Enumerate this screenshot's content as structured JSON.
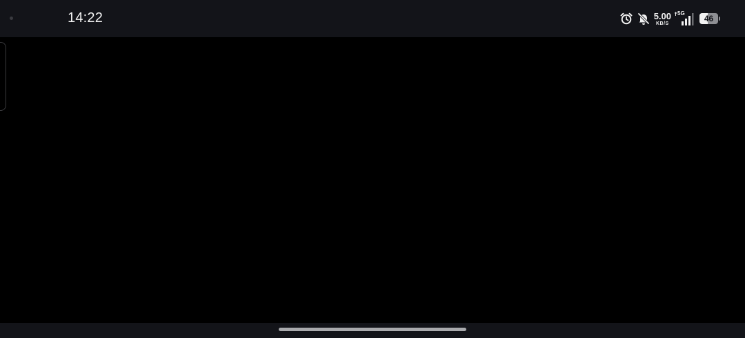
{
  "status_bar": {
    "time": "14:22",
    "network_speed_value": "5.00",
    "network_speed_unit": "KB/S",
    "network_type": "5G",
    "battery_level": "46",
    "battery_fraction": 0.46,
    "icons": [
      "camera-dot",
      "alarm-icon",
      "bell-off-icon",
      "signal-icon",
      "battery-icon"
    ]
  },
  "colors": {
    "background": "#000000",
    "bars": "#131419",
    "text": "#f2f2f2",
    "home_indicator": "#a9aaad"
  }
}
